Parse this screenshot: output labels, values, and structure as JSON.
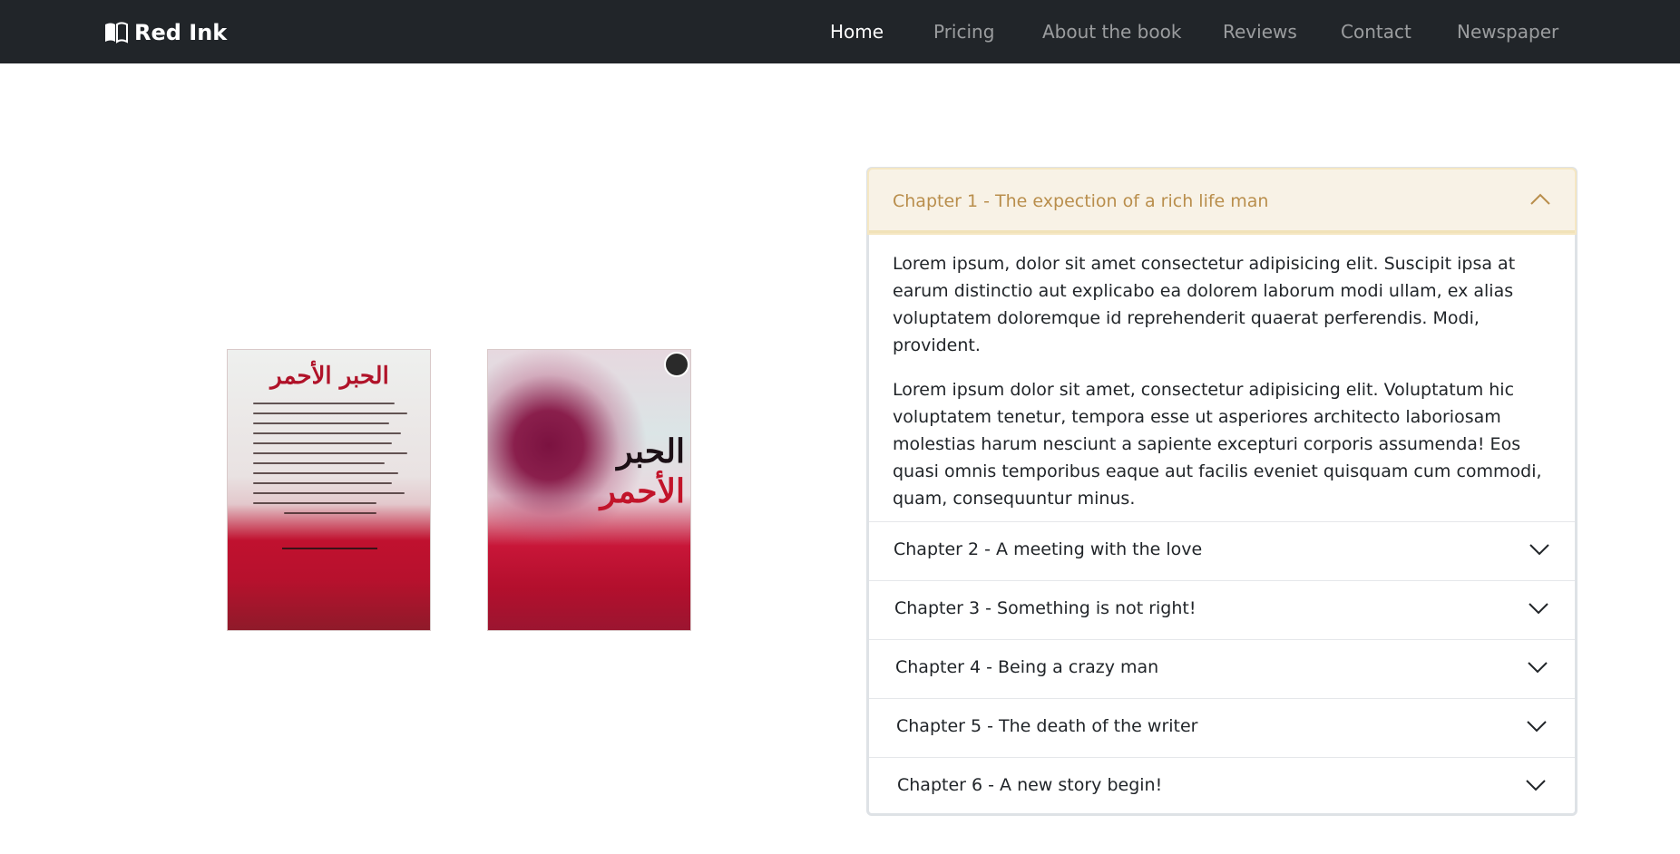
{
  "navbar": {
    "brand": "Red Ink",
    "brand_icon": "open-book-icon",
    "links": [
      {
        "label": "Home",
        "active": true
      },
      {
        "label": "Pricing",
        "active": false
      },
      {
        "label": "About the book",
        "active": false
      },
      {
        "label": "Reviews",
        "active": false
      },
      {
        "label": "Contact",
        "active": false
      },
      {
        "label": "Newspaper",
        "active": false
      }
    ]
  },
  "book": {
    "back_cover_title": "الحبر الأحمر",
    "front_cover_title_line1": "الحبر",
    "front_cover_title_line2": "الأحمر"
  },
  "accordion": {
    "open_item": {
      "title": "Chapter 1 - The expection of a rich life man",
      "paragraphs": [
        "Lorem ipsum, dolor sit amet consectetur adipisicing elit. Suscipit ipsa at earum distinctio aut explicabo ea dolorem laborum modi ullam, ex alias voluptatem doloremque id reprehenderit quaerat perferendis. Modi, provident.",
        "Lorem ipsum dolor sit amet, consectetur adipisicing elit. Voluptatum hic voluptatem tenetur, tempora esse ut asperiores architecto laboriosam molestias harum nesciunt a sapiente excepturi corporis assumenda! Eos quasi omnis temporibus eaque aut facilis eveniet quisquam cum commodi, quam, consequuntur minus."
      ]
    },
    "items": [
      "Chapter 2 - A meeting with the love",
      "Chapter 3 - Something is not right!",
      "Chapter 4 - Being a crazy man",
      "Chapter 5 - The death of the writer",
      "Chapter 6 - A new story begin!"
    ]
  },
  "colors": {
    "navbar_bg": "#212529",
    "accordion_active_text": "#b98e4c",
    "accordion_active_bg": "#f8f2e6"
  }
}
